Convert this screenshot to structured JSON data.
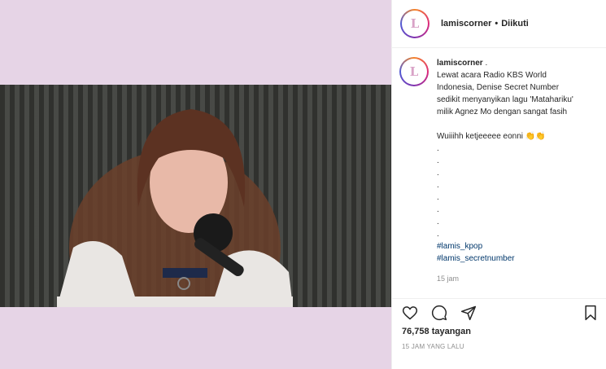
{
  "post": {
    "account": "lamiscorner",
    "avatar_letter": "L",
    "header_separator": "•",
    "follow_status": "Diikuti"
  },
  "caption": {
    "username": "lamiscorner",
    "user_suffix": ".",
    "lines": [
      "Lewat acara Radio KBS World",
      "Indonesia, Denise Secret Number",
      "sedikit menyanyikan lagu 'Matahariku'",
      "milik Agnez Mo dengan sangat fasih"
    ],
    "exclaim": "Wuiiihh ketjeeeee eonni 👏👏",
    "dots": [
      ".",
      ".",
      ".",
      ".",
      ".",
      ".",
      ".",
      "."
    ],
    "hashtags": [
      "#lamis_kpop",
      "#lamis_secretnumber"
    ],
    "age": "15 jam"
  },
  "actions": {
    "like_icon": "heart-icon",
    "comment_icon": "comment-icon",
    "share_icon": "share-icon",
    "save_icon": "bookmark-icon"
  },
  "stats": {
    "views": "76,758 tayangan",
    "timestamp": "15 JAM YANG LALU"
  },
  "colors": {
    "media_background": "#e6d4e6",
    "hashtag": "#00376b",
    "muted": "#8e8e8e"
  }
}
